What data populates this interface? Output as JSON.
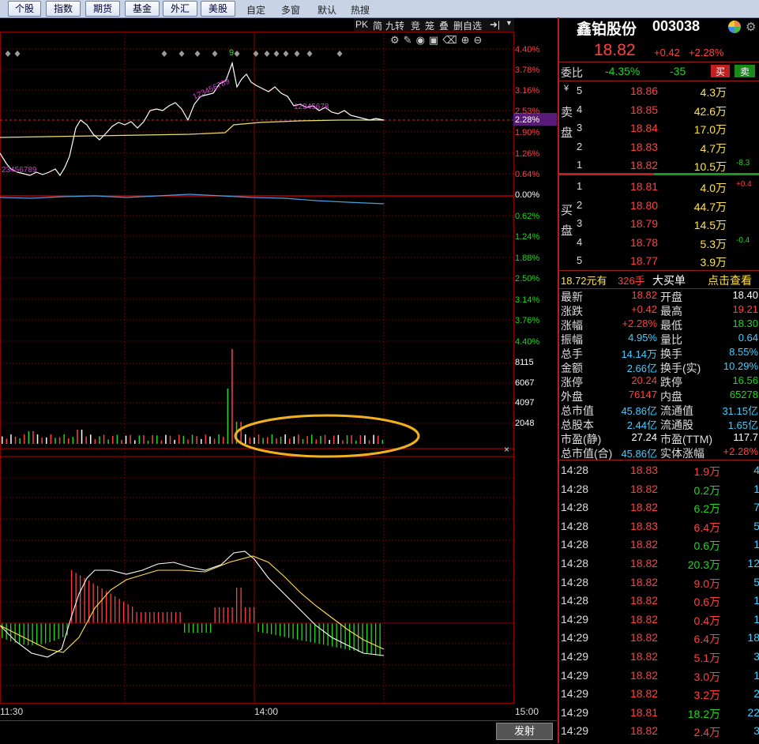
{
  "tabs": [
    "个股",
    "指数",
    "期货",
    "基金",
    "外汇",
    "美股"
  ],
  "tabs_plain": [
    "自定",
    "多窗",
    "默认",
    "热搜"
  ],
  "toolbar": {
    "pk": "PK",
    "jian": "简",
    "jiuzhuan": "九转",
    "jing": "竞",
    "long": "笼",
    "die": "叠",
    "delete_self": "删自选"
  },
  "stock": {
    "name": "鑫铂股份",
    "code": "003038",
    "price": "18.82",
    "change": "+0.42",
    "pct": "+2.28%"
  },
  "weibi": {
    "label": "委比",
    "pct": "-4.35%",
    "diff": "-35",
    "buy": "买",
    "sell": "卖"
  },
  "sell_side_label": "卖盘",
  "buy_side_label": "买盘",
  "yen": "¥",
  "asks": [
    {
      "lvl": "5",
      "price": "18.86",
      "vol": "4.3万",
      "chg": ""
    },
    {
      "lvl": "4",
      "price": "18.85",
      "vol": "42.6万",
      "chg": ""
    },
    {
      "lvl": "3",
      "price": "18.84",
      "vol": "17.0万",
      "chg": ""
    },
    {
      "lvl": "2",
      "price": "18.83",
      "vol": "4.7万",
      "chg": ""
    },
    {
      "lvl": "1",
      "price": "18.82",
      "vol": "10.5万",
      "chg": "-8.3"
    }
  ],
  "bids": [
    {
      "lvl": "1",
      "price": "18.81",
      "vol": "4.0万",
      "chg": "+0.4"
    },
    {
      "lvl": "2",
      "price": "18.80",
      "vol": "44.7万",
      "chg": ""
    },
    {
      "lvl": "3",
      "price": "18.79",
      "vol": "14.5万",
      "chg": ""
    },
    {
      "lvl": "4",
      "price": "18.78",
      "vol": "5.3万",
      "chg": "-0.4"
    },
    {
      "lvl": "5",
      "price": "18.77",
      "vol": "3.9万",
      "chg": ""
    }
  ],
  "big_order": {
    "price": "18.72元有",
    "qty": "326手",
    "label": "大买单",
    "link": "点击查看"
  },
  "quote": [
    {
      "k1": "最新",
      "v1": "18.82",
      "c1": "red",
      "k2": "开盘",
      "v2": "18.40",
      "c2": "white"
    },
    {
      "k1": "涨跌",
      "v1": "+0.42",
      "c1": "red",
      "k2": "最高",
      "v2": "19.21",
      "c2": "red"
    },
    {
      "k1": "涨幅",
      "v1": "+2.28%",
      "c1": "red",
      "k2": "最低",
      "v2": "18.30",
      "c2": "green"
    },
    {
      "k1": "振幅",
      "v1": "4.95%",
      "c1": "cyan",
      "k2": "量比",
      "v2": "0.64",
      "c2": "cyan"
    },
    {
      "k1": "总手",
      "v1": "14.14万",
      "c1": "cyan",
      "k2": "换手",
      "v2": "8.55%",
      "c2": "cyan"
    },
    {
      "k1": "金额",
      "v1": "2.66亿",
      "c1": "cyan",
      "k2": "换手(实)",
      "v2": "10.29%",
      "c2": "cyan"
    },
    {
      "k1": "涨停",
      "v1": "20.24",
      "c1": "red",
      "k2": "跌停",
      "v2": "16.56",
      "c2": "green"
    },
    {
      "k1": "外盘",
      "v1": "76147",
      "c1": "red",
      "k2": "内盘",
      "v2": "65278",
      "c2": "green"
    },
    {
      "k1": "总市值",
      "v1": "45.86亿",
      "c1": "cyan",
      "k2": "流通值",
      "v2": "31.15亿",
      "c2": "cyan"
    },
    {
      "k1": "总股本",
      "v1": "2.44亿",
      "c1": "cyan",
      "k2": "流通股",
      "v2": "1.65亿",
      "c2": "cyan"
    },
    {
      "k1": "市盈(静)",
      "v1": "27.24",
      "c1": "white",
      "k2": "市盈(TTM)",
      "v2": "117.7",
      "c2": "white"
    },
    {
      "k1": "总市值(合)",
      "v1": "45.86亿",
      "c1": "cyan",
      "k2": "实体涨幅",
      "v2": "+2.28%",
      "c2": "red"
    }
  ],
  "ticks": [
    {
      "t": "14:28",
      "p": "18.83",
      "v": "1.9万",
      "n": "4",
      "c": "red"
    },
    {
      "t": "14:28",
      "p": "18.82",
      "v": "0.2万",
      "n": "1",
      "c": "green"
    },
    {
      "t": "14:28",
      "p": "18.82",
      "v": "6.2万",
      "n": "7",
      "c": "green"
    },
    {
      "t": "14:28",
      "p": "18.83",
      "v": "6.4万",
      "n": "5",
      "c": "red"
    },
    {
      "t": "14:28",
      "p": "18.82",
      "v": "0.6万",
      "n": "1",
      "c": "green"
    },
    {
      "t": "14:28",
      "p": "18.82",
      "v": "20.3万",
      "n": "12",
      "c": "green"
    },
    {
      "t": "14:28",
      "p": "18.82",
      "v": "9.0万",
      "n": "5",
      "c": "red"
    },
    {
      "t": "14:28",
      "p": "18.82",
      "v": "0.6万",
      "n": "1",
      "c": "red"
    },
    {
      "t": "14:29",
      "p": "18.82",
      "v": "0.4万",
      "n": "1",
      "c": "red"
    },
    {
      "t": "14:29",
      "p": "18.82",
      "v": "6.4万",
      "n": "18",
      "c": "red"
    },
    {
      "t": "14:29",
      "p": "18.82",
      "v": "5.1万",
      "n": "3",
      "c": "red"
    },
    {
      "t": "14:29",
      "p": "18.82",
      "v": "3.0万",
      "n": "1",
      "c": "red"
    },
    {
      "t": "14:29",
      "p": "18.82",
      "v": "3.2万",
      "n": "2",
      "c": "red"
    },
    {
      "t": "14:29",
      "p": "18.81",
      "v": "18.2万",
      "n": "22",
      "c": "green"
    },
    {
      "t": "14:29",
      "p": "18.82",
      "v": "2.4万",
      "n": "3",
      "c": "red"
    }
  ],
  "axis": {
    "pct_up": [
      "4.40%",
      "3.78%",
      "3.16%",
      "2.53%",
      "1.90%",
      "1.26%",
      "0.64%",
      "0.00%"
    ],
    "pct_down": [
      "0.62%",
      "1.24%",
      "1.88%",
      "2.50%",
      "3.14%",
      "3.76%",
      "4.40%"
    ],
    "current_tag": "2.28%",
    "vol": [
      "8115",
      "6067",
      "4097",
      "2048"
    ],
    "time": [
      "11:30",
      "14:00",
      "15:00"
    ]
  },
  "send_button": "发射",
  "seq_numbers_low": "23456789",
  "seq_numbers_high": "123456789",
  "seq_numbers_mid": "12345678",
  "seq_top": "9",
  "close_glyph": "×"
}
